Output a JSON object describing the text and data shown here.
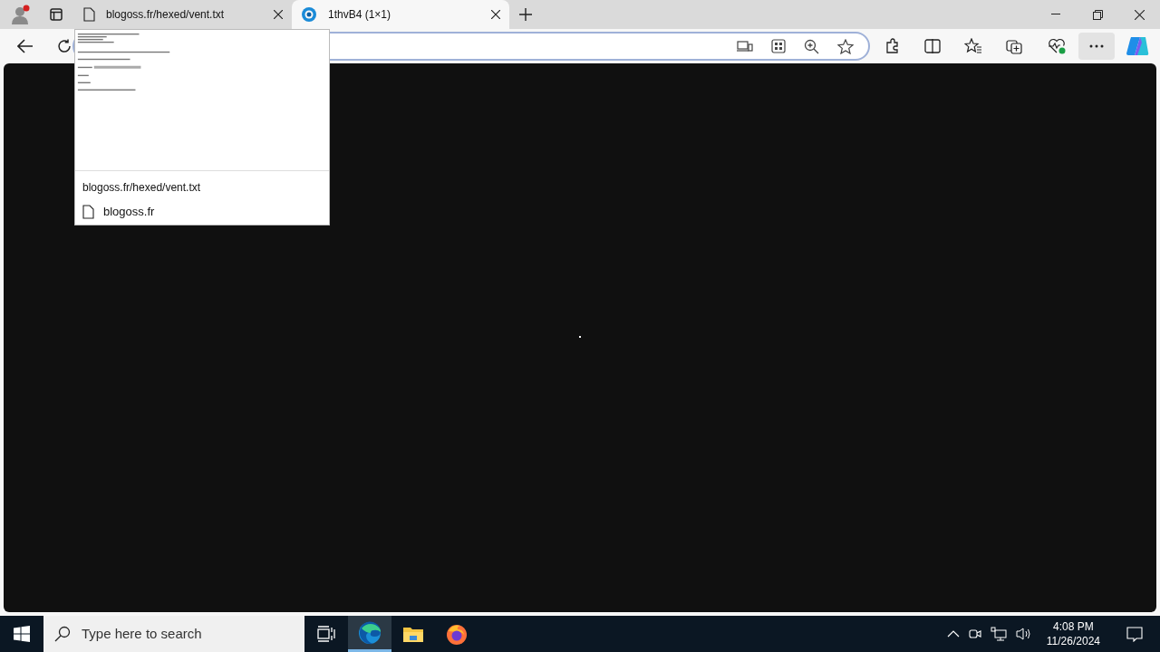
{
  "tabs": [
    {
      "title": "blogoss.fr/hexed/vent.txt",
      "kind": "document",
      "selected": false
    },
    {
      "title": "1thvB4 (1×1)",
      "kind": "loading",
      "selected": true
    }
  ],
  "tab_preview": {
    "url": "blogoss.fr/hexed/vent.txt",
    "site": "blogoss.fr"
  },
  "taskbar": {
    "search_placeholder": "Type here to search",
    "apps": [
      {
        "kind": "task-view",
        "selected": false
      },
      {
        "kind": "edge",
        "selected": true
      },
      {
        "kind": "explorer",
        "selected": false
      },
      {
        "kind": "firefox",
        "selected": false
      }
    ],
    "time": "4:08 PM",
    "date": "11/26/2024"
  }
}
